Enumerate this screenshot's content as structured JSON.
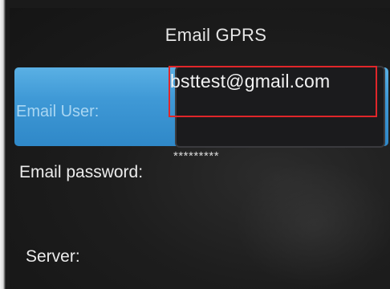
{
  "screen": {
    "title": "Email GPRS"
  },
  "fields": {
    "email_user": {
      "label": "Email User:",
      "value": "bsttest@gmail.com"
    },
    "email_password": {
      "label": "Email password:",
      "value": "*********"
    },
    "server": {
      "label": "Server:"
    }
  },
  "colors": {
    "highlight": "#3f99d6",
    "selection_outline": "#e0262a",
    "background": "#1b1b1b"
  }
}
